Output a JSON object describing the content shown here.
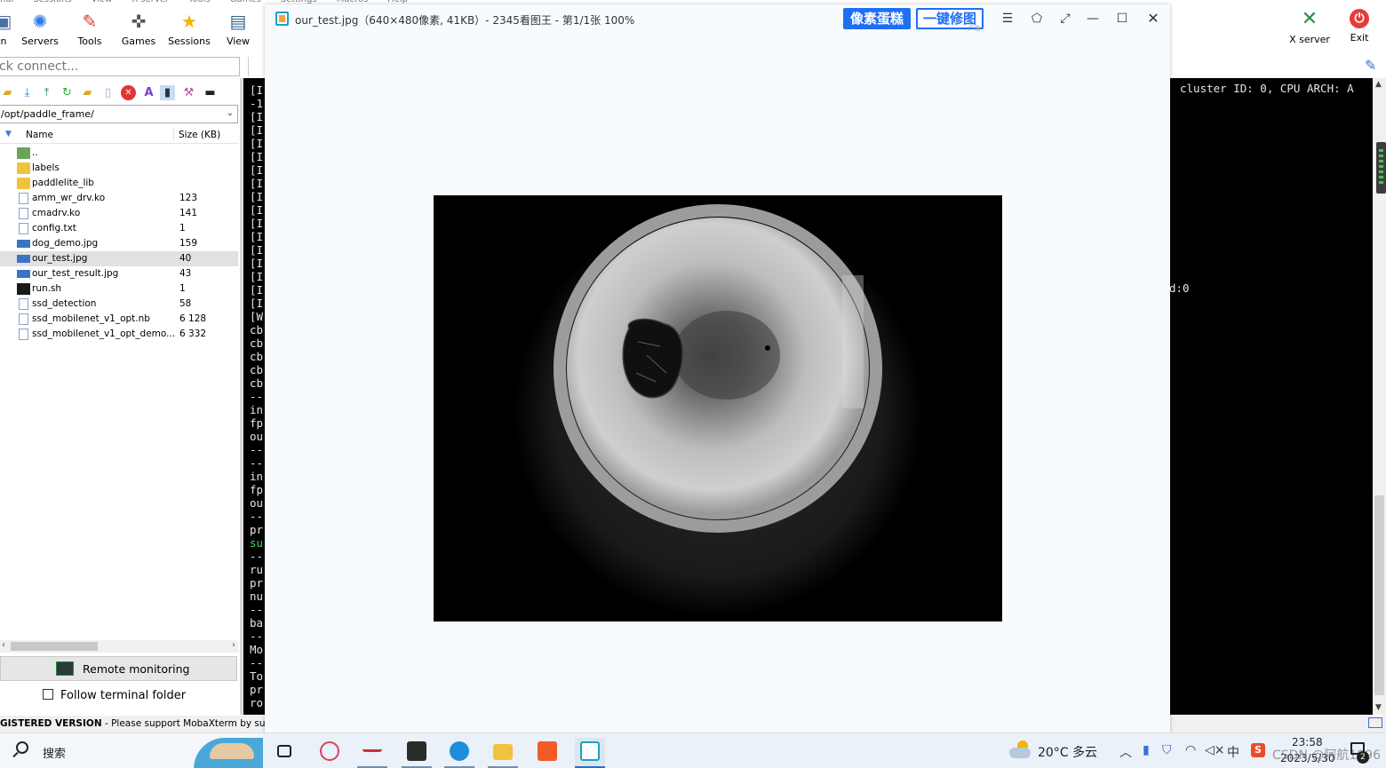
{
  "moba": {
    "menubar": [
      "nal",
      "Sessions",
      "View",
      "X server",
      "Tools",
      "Games",
      "Settings",
      "Macros",
      "Help"
    ],
    "toolbar": {
      "items": [
        {
          "label": "n",
          "icon": "session-icon"
        },
        {
          "label": "Servers",
          "icon": "servers-icon"
        },
        {
          "label": "Tools",
          "icon": "tools-icon"
        },
        {
          "label": "Games",
          "icon": "games-icon"
        },
        {
          "label": "Sessions",
          "icon": "sessions-star-icon"
        },
        {
          "label": "View",
          "icon": "view-icon"
        }
      ],
      "xserver_label": "X server",
      "exit_label": "Exit"
    },
    "quick_connect_placeholder": "ck connect...",
    "sftp_path": "/opt/paddle_frame/",
    "file_columns": {
      "name": "Name",
      "size": "Size (KB)"
    },
    "files": [
      {
        "name": "..",
        "size": "",
        "type": "parent",
        "selected": false
      },
      {
        "name": "labels",
        "size": "",
        "type": "folder",
        "selected": false
      },
      {
        "name": "paddlelite_lib",
        "size": "",
        "type": "folder",
        "selected": false
      },
      {
        "name": "amm_wr_drv.ko",
        "size": "123",
        "type": "file",
        "selected": false
      },
      {
        "name": "cmadrv.ko",
        "size": "141",
        "type": "file",
        "selected": false
      },
      {
        "name": "config.txt",
        "size": "1",
        "type": "file",
        "selected": false
      },
      {
        "name": "dog_demo.jpg",
        "size": "159",
        "type": "img",
        "selected": false
      },
      {
        "name": "our_test.jpg",
        "size": "40",
        "type": "img",
        "selected": true
      },
      {
        "name": "our_test_result.jpg",
        "size": "43",
        "type": "img",
        "selected": false
      },
      {
        "name": "run.sh",
        "size": "1",
        "type": "sh",
        "selected": false
      },
      {
        "name": "ssd_detection",
        "size": "58",
        "type": "file",
        "selected": false
      },
      {
        "name": "ssd_mobilenet_v1_opt.nb",
        "size": "6 128",
        "type": "file",
        "selected": false
      },
      {
        "name": "ssd_mobilenet_v1_opt_demo...",
        "size": "6 332",
        "type": "file",
        "selected": false
      }
    ],
    "remote_monitoring": "Remote monitoring",
    "follow_terminal_folder": "Follow terminal folder",
    "terminal_left_lines": [
      "[I",
      "-1",
      "[I",
      "[I",
      "[I",
      "[I",
      "[I",
      "[I",
      "[I",
      "[I",
      "[I",
      "[I",
      "[I",
      "[I",
      "[I",
      "[I",
      "[I",
      "[W",
      "cb",
      "cb",
      "cb",
      "cb",
      "cb",
      "--",
      "in",
      "fp",
      "ou",
      "--",
      "--",
      "in",
      "fp",
      "ou",
      "--",
      "pr",
      "su",
      "--",
      "ru",
      "pr",
      "nu",
      "--",
      "ba",
      "--",
      "Mo",
      "--",
      "To",
      "pr",
      "ro"
    ],
    "terminal_right_1": "cluster ID: 0, CPU ARCH: A",
    "terminal_right_2": "d:0",
    "status_bold": "GISTERED VERSION",
    "status_text": " -  Please support MobaXterm by subscrib"
  },
  "viewer": {
    "title": "our_test.jpg（640×480像素, 41KB）- 2345看图王 - 第1/1张 100%",
    "btn_pixel": "像素蛋糕",
    "btn_fix": "一键修图",
    "ad": "广告"
  },
  "taskbar": {
    "search": "搜索",
    "weather": "20°C  多云",
    "ime": "中",
    "time": "23:58",
    "date": "2023/5/30",
    "watermark": "CSDN @阿航1996",
    "notif_count": "2"
  }
}
